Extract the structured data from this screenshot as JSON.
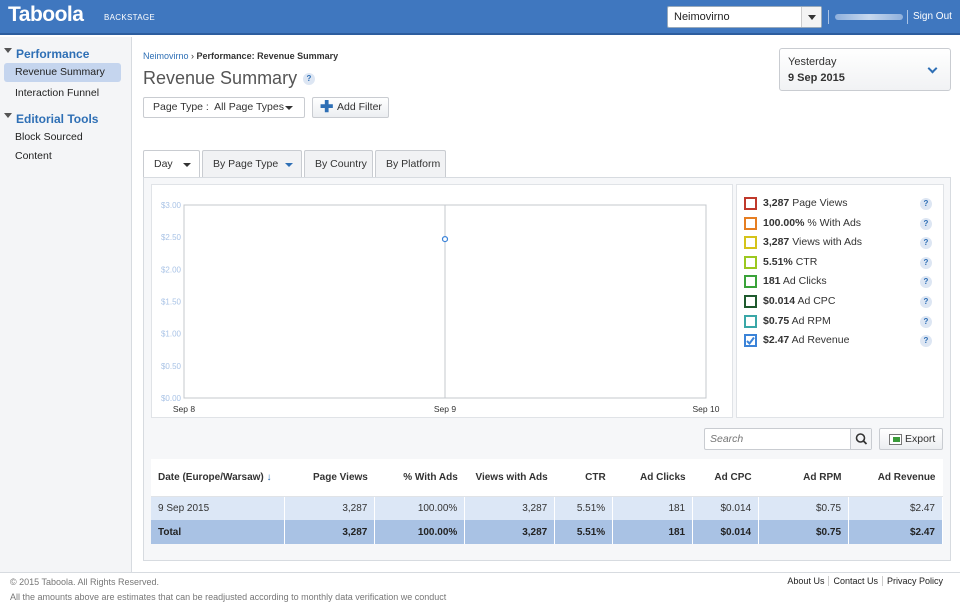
{
  "header": {
    "logo": "Taboola",
    "logo_sub": "BACKSTAGE",
    "account": "Neimovirno",
    "signout": "Sign Out"
  },
  "sidebar": {
    "sections": [
      {
        "title": "Performance",
        "items": [
          "Revenue Summary",
          "Interaction Funnel"
        ]
      },
      {
        "title": "Editorial Tools",
        "items": [
          "Block Sourced Content"
        ]
      }
    ]
  },
  "breadcrumb": {
    "root": "Neimovirno",
    "sep": "›",
    "current": "Performance: Revenue Summary"
  },
  "page": {
    "title": "Revenue Summary",
    "help": "?"
  },
  "date": {
    "range": "Yesterday",
    "date": "9 Sep 2015"
  },
  "filters": {
    "page_type_label": "Page Type :",
    "page_type_value": "All Page Types",
    "add_filter": "Add Filter"
  },
  "tabs": [
    "Day",
    "By Page Type",
    "By Country",
    "By Platform"
  ],
  "colors": {
    "brand": "#3f77bf",
    "accent": "#2e6fb5",
    "row": "#dce7f6",
    "total": "#a9c2e4"
  },
  "chart_data": {
    "type": "line",
    "x": [
      "Sep 8",
      "Sep 9",
      "Sep 10"
    ],
    "series": [
      {
        "name": "Ad Revenue",
        "values": [
          null,
          2.47,
          null
        ]
      }
    ],
    "ytick_labels": [
      "$0.00",
      "$0.50",
      "$1.00",
      "$1.50",
      "$2.00",
      "$2.50",
      "$3.00"
    ],
    "ylim": [
      0,
      3
    ],
    "grid": false,
    "legend_position": "right"
  },
  "legend": [
    {
      "value": "3,287",
      "label": "Page Views",
      "color": "#c0392b",
      "checked": false
    },
    {
      "value": "100.00%",
      "label": "% With Ads",
      "color": "#e67e22",
      "checked": false
    },
    {
      "value": "3,287",
      "label": "Views with Ads",
      "color": "#d4c41a",
      "checked": false
    },
    {
      "value": "5.51%",
      "label": "CTR",
      "color": "#9cc81f",
      "checked": false
    },
    {
      "value": "181",
      "label": "Ad Clicks",
      "color": "#3aa33a",
      "checked": false
    },
    {
      "value": "$0.014",
      "label": "Ad CPC",
      "color": "#1f5a2e",
      "checked": false
    },
    {
      "value": "$0.75",
      "label": "Ad RPM",
      "color": "#3aa7a7",
      "checked": false
    },
    {
      "value": "$2.47",
      "label": "Ad Revenue",
      "color": "#3b83d8",
      "checked": true
    }
  ],
  "search": {
    "placeholder": "Search"
  },
  "export": "Export",
  "table": {
    "headers": [
      "Date (Europe/Warsaw)",
      "Page Views",
      "% With Ads",
      "Views with Ads",
      "CTR",
      "Ad Clicks",
      "Ad CPC",
      "Ad RPM",
      "Ad Revenue"
    ],
    "sort_arrow": "↓",
    "rows": [
      [
        "9 Sep 2015",
        "3,287",
        "100.00%",
        "3,287",
        "5.51%",
        "181",
        "$0.014",
        "$0.75",
        "$2.47"
      ]
    ],
    "total": [
      "Total",
      "3,287",
      "100.00%",
      "3,287",
      "5.51%",
      "181",
      "$0.014",
      "$0.75",
      "$2.47"
    ]
  },
  "footer": {
    "copyright": "© 2015 Taboola. All Rights Reserved.",
    "note": "All the amounts above are estimates that can be readjusted according to monthly data verification we conduct",
    "links": [
      "About Us",
      "Contact Us",
      "Privacy Policy"
    ]
  }
}
